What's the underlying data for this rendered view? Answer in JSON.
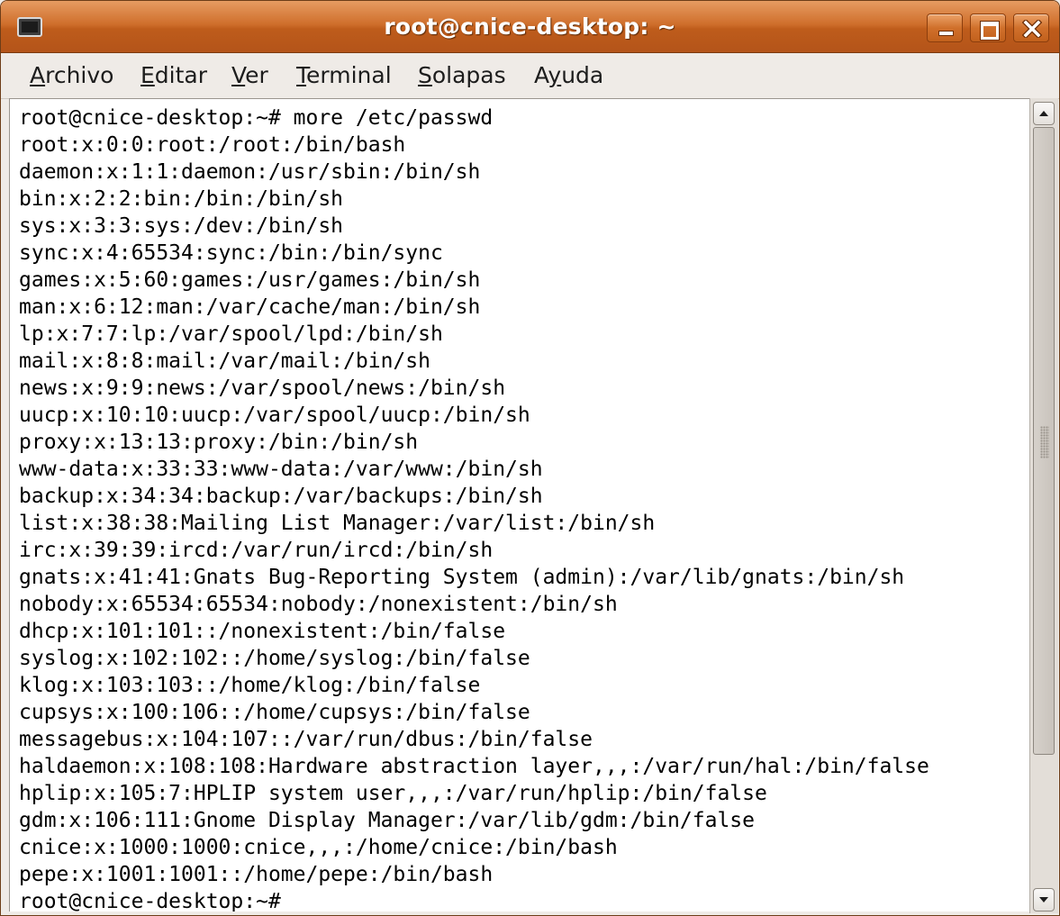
{
  "window": {
    "title": "root@cnice-desktop: ~"
  },
  "menu": {
    "items": [
      {
        "label_ul": "A",
        "label_rest": "rchivo"
      },
      {
        "label_ul": "E",
        "label_rest": "ditar"
      },
      {
        "label_ul": "V",
        "label_rest": "er"
      },
      {
        "label_ul": "T",
        "label_rest": "erminal"
      },
      {
        "label_ul": "S",
        "label_rest": "olapas"
      },
      {
        "label_pre": "A",
        "label_ul": "y",
        "label_rest": "uda"
      }
    ]
  },
  "terminal": {
    "lines": [
      "root@cnice-desktop:~# more /etc/passwd",
      "root:x:0:0:root:/root:/bin/bash",
      "daemon:x:1:1:daemon:/usr/sbin:/bin/sh",
      "bin:x:2:2:bin:/bin:/bin/sh",
      "sys:x:3:3:sys:/dev:/bin/sh",
      "sync:x:4:65534:sync:/bin:/bin/sync",
      "games:x:5:60:games:/usr/games:/bin/sh",
      "man:x:6:12:man:/var/cache/man:/bin/sh",
      "lp:x:7:7:lp:/var/spool/lpd:/bin/sh",
      "mail:x:8:8:mail:/var/mail:/bin/sh",
      "news:x:9:9:news:/var/spool/news:/bin/sh",
      "uucp:x:10:10:uucp:/var/spool/uucp:/bin/sh",
      "proxy:x:13:13:proxy:/bin:/bin/sh",
      "www-data:x:33:33:www-data:/var/www:/bin/sh",
      "backup:x:34:34:backup:/var/backups:/bin/sh",
      "list:x:38:38:Mailing List Manager:/var/list:/bin/sh",
      "irc:x:39:39:ircd:/var/run/ircd:/bin/sh",
      "gnats:x:41:41:Gnats Bug-Reporting System (admin):/var/lib/gnats:/bin/sh",
      "nobody:x:65534:65534:nobody:/nonexistent:/bin/sh",
      "dhcp:x:101:101::/nonexistent:/bin/false",
      "syslog:x:102:102::/home/syslog:/bin/false",
      "klog:x:103:103::/home/klog:/bin/false",
      "cupsys:x:100:106::/home/cupsys:/bin/false",
      "messagebus:x:104:107::/var/run/dbus:/bin/false",
      "haldaemon:x:108:108:Hardware abstraction layer,,,:/var/run/hal:/bin/false",
      "hplip:x:105:7:HPLIP system user,,,:/var/run/hplip:/bin/false",
      "gdm:x:106:111:Gnome Display Manager:/var/lib/gdm:/bin/false",
      "cnice:x:1000:1000:cnice,,,:/home/cnice:/bin/bash",
      "pepe:x:1001:1001::/home/pepe:/bin/bash",
      "root@cnice-desktop:~#"
    ]
  },
  "scrollbar": {
    "position": 0.0,
    "visible_fraction": 0.83
  },
  "icons": {
    "window": "terminal-window-icon",
    "minimize": "minimize-icon",
    "maximize": "maximize-icon",
    "close": "close-icon",
    "scroll_up": "arrow-up-icon",
    "scroll_down": "arrow-down-icon"
  },
  "colors": {
    "titlebar": "#cf6f2c",
    "menubar": "#efebe7",
    "terminal_bg": "#ffffff",
    "terminal_fg": "#000000"
  }
}
